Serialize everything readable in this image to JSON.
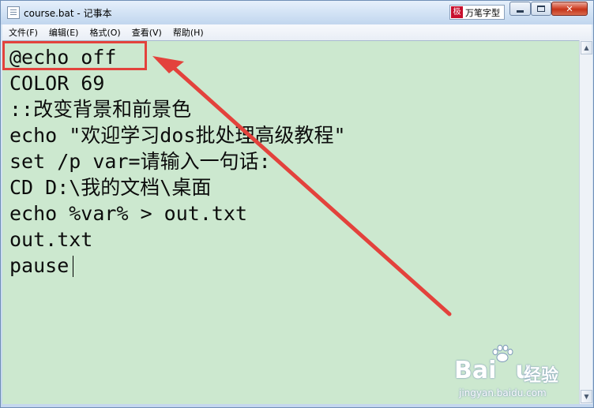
{
  "window": {
    "title": "course.bat - 记事本",
    "ime_label": "万笔字型",
    "ime_logo_char": "极",
    "close_glyph": "✕"
  },
  "menu": {
    "items": [
      {
        "label": "文件(F)"
      },
      {
        "label": "编辑(E)"
      },
      {
        "label": "格式(O)"
      },
      {
        "label": "查看(V)"
      },
      {
        "label": "帮助(H)"
      }
    ]
  },
  "editor": {
    "background": "#cce8cf",
    "lines": [
      "@echo off",
      "COLOR 69",
      "::改变背景和前景色",
      "echo \"欢迎学习dos批处理高级教程\"",
      "set /p var=请输入一句话:",
      "CD D:\\我的文档\\桌面",
      "echo %var% > out.txt",
      "out.txt",
      "pause"
    ]
  },
  "annotation": {
    "color": "#e3423c"
  },
  "watermark": {
    "brand": "Bai",
    "brand_suffix": "u",
    "cn": "经验",
    "url": "jingyan.baidu.com"
  },
  "scrollbar": {
    "up_glyph": "▲",
    "down_glyph": "▼"
  }
}
